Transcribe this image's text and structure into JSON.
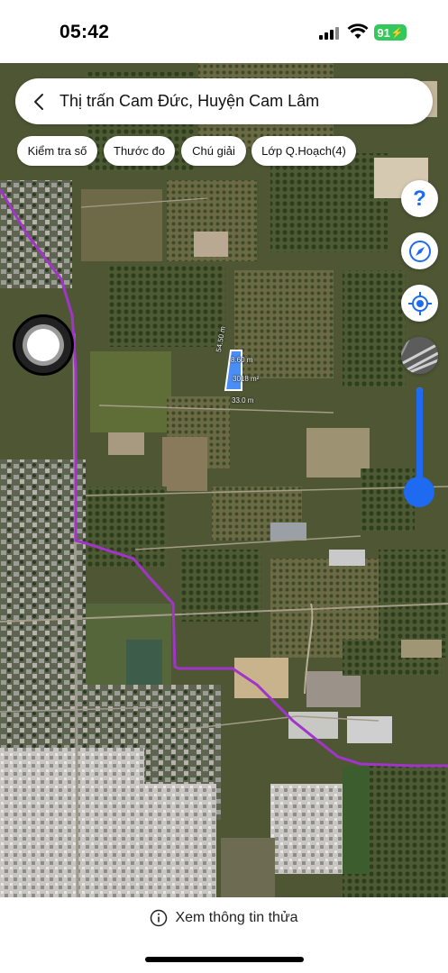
{
  "status_bar": {
    "time": "05:42",
    "battery": "91",
    "icons": [
      "cellular-signal-icon",
      "wifi-icon",
      "battery-charging-icon"
    ]
  },
  "header": {
    "title": "Thị trấn Cam Đức, Huyện Cam Lâm",
    "back_icon": "chevron-left-icon"
  },
  "toolbar": {
    "chips": [
      {
        "label": "Kiểm tra số"
      },
      {
        "label": "Thước đo"
      },
      {
        "label": "Chú giải"
      },
      {
        "label": "Lớp Q.Hoạch(4)"
      }
    ]
  },
  "map_controls": {
    "help_icon": "question-mark-icon",
    "compass_icon": "compass-icon",
    "locate_icon": "crosshair-location-icon",
    "layer_icon": "satellite-layer-icon",
    "opacity_level": 0.95,
    "accent_color": "#1e6af0"
  },
  "parcel": {
    "side_top": "8.60 m",
    "side_left": "54.50 m",
    "area": "3018 m²",
    "side_bottom": "33.0 m",
    "border_color": "#ffffff",
    "fill_color": "#4a8df5"
  },
  "boundary": {
    "color": "#a235c9"
  },
  "footer": {
    "info_icon": "info-circle-icon",
    "label": "Xem thông tin thửa"
  }
}
